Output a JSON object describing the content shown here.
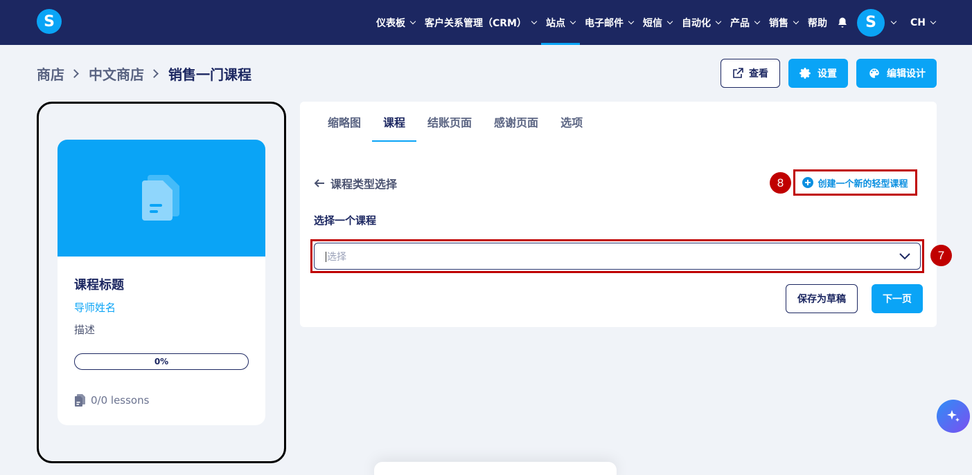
{
  "nav": {
    "logo": "S",
    "items": [
      {
        "label": "仪表板",
        "chevron": true
      },
      {
        "label": "客户关系管理（CRM）",
        "chevron": true
      },
      {
        "label": "站点",
        "chevron": true,
        "active": true
      },
      {
        "label": "电子邮件",
        "chevron": true
      },
      {
        "label": "短信",
        "chevron": true
      },
      {
        "label": "自动化",
        "chevron": true
      },
      {
        "label": "产品",
        "chevron": true
      },
      {
        "label": "销售",
        "chevron": true
      },
      {
        "label": "帮助",
        "chevron": false
      }
    ],
    "avatar": "S",
    "language": "CH"
  },
  "breadcrumb": [
    "商店",
    "中文商店",
    "销售一门课程"
  ],
  "actions": {
    "view_label": "查看",
    "settings_label": "设置",
    "edit_design_label": "编辑设计"
  },
  "preview": {
    "title": "课程标题",
    "instructor": "导师姓名",
    "description": "描述",
    "progress_text": "0%",
    "progress": 0,
    "lessons": "0/0 lessons"
  },
  "panel": {
    "tabs": [
      {
        "label": "缩略图",
        "active": false
      },
      {
        "label": "课程",
        "active": true
      },
      {
        "label": "结账页面",
        "active": false
      },
      {
        "label": "感谢页面",
        "active": false
      },
      {
        "label": "选项",
        "active": false
      }
    ],
    "back_label": "课程类型选择",
    "create_label": "创建一个新的轻型课程",
    "select_label": "选择一个课程",
    "select_placeholder": "选择",
    "save_draft_label": "保存为草稿",
    "next_label": "下一页"
  },
  "annotations": {
    "badge_select": "7",
    "badge_create": "8"
  },
  "colors": {
    "nav_bg": "#1c2761",
    "accent": "#0aa4f6",
    "highlight": "#c00000"
  }
}
